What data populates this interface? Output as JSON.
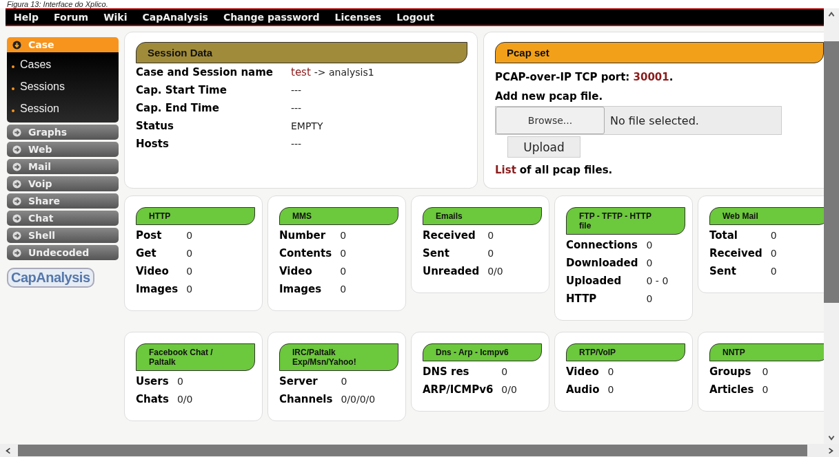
{
  "caption": "Figura 13: Interface do Xplico.",
  "nav": [
    "Help",
    "Forum",
    "Wiki",
    "CapAnalysis",
    "Change password",
    "Licenses",
    "Logout"
  ],
  "sidebar": {
    "items": [
      {
        "label": "Case",
        "selected": true,
        "expanded": true,
        "children": [
          "Cases",
          "Sessions",
          "Session"
        ]
      },
      {
        "label": "Graphs",
        "selected": false,
        "expanded": false
      },
      {
        "label": "Web",
        "selected": false,
        "expanded": false
      },
      {
        "label": "Mail",
        "selected": false,
        "expanded": false
      },
      {
        "label": "Voip",
        "selected": false,
        "expanded": false
      },
      {
        "label": "Share",
        "selected": false,
        "expanded": false
      },
      {
        "label": "Chat",
        "selected": false,
        "expanded": false
      },
      {
        "label": "Shell",
        "selected": false,
        "expanded": false
      },
      {
        "label": "Undecoded",
        "selected": false,
        "expanded": false
      }
    ],
    "logo": "CapAnalysis"
  },
  "session_data": {
    "title": "Session Data",
    "rows": [
      {
        "label": "Case and Session name",
        "link": "test",
        "value": "-> analysis1"
      },
      {
        "label": "Cap. Start Time",
        "value": "---"
      },
      {
        "label": "Cap. End Time",
        "value": "---"
      },
      {
        "label": "Status",
        "value": "EMPTY"
      },
      {
        "label": "Hosts",
        "value": "---"
      }
    ]
  },
  "pcap_set": {
    "title": "Pcap set",
    "port_label": "PCAP-over-IP TCP port:",
    "port": "30001",
    "port_end": ".",
    "add_label": "Add new pcap file.",
    "browse_button": "Browse...",
    "file_status": "No file selected.",
    "upload_button": "Upload",
    "list_link": "List",
    "list_text": "of all pcap files."
  },
  "cards": [
    {
      "title": "HTTP",
      "rows": [
        {
          "label": "Post",
          "value": "0"
        },
        {
          "label": "Get",
          "value": "0"
        },
        {
          "label": "Video",
          "value": "0"
        },
        {
          "label": "Images",
          "value": "0"
        }
      ]
    },
    {
      "title": "MMS",
      "rows": [
        {
          "label": "Number",
          "value": "0"
        },
        {
          "label": "Contents",
          "value": "0"
        },
        {
          "label": "Video",
          "value": "0"
        },
        {
          "label": "Images",
          "value": "0"
        }
      ]
    },
    {
      "title": "Emails",
      "rows": [
        {
          "label": "Received",
          "value": "0"
        },
        {
          "label": "Sent",
          "value": "0"
        },
        {
          "label": "Unreaded",
          "value": "0/0"
        }
      ]
    },
    {
      "title": "FTP - TFTP - HTTP file",
      "rows": [
        {
          "label": "Connections",
          "value": "0"
        },
        {
          "label": "Downloaded",
          "value": "0"
        },
        {
          "label": "Uploaded",
          "value": "0 - 0"
        },
        {
          "label": "HTTP",
          "value": "0"
        }
      ]
    },
    {
      "title": "Web Mail",
      "rows": [
        {
          "label": "Total",
          "value": "0"
        },
        {
          "label": "Received",
          "value": "0"
        },
        {
          "label": "Sent",
          "value": "0"
        }
      ]
    },
    {
      "title": "Facebook Chat / Paltalk",
      "rows": [
        {
          "label": "Users",
          "value": "0"
        },
        {
          "label": "Chats",
          "value": "0/0"
        }
      ]
    },
    {
      "title": "IRC/Paltalk Exp/Msn/Yahoo!",
      "rows": [
        {
          "label": "Server",
          "value": "0"
        },
        {
          "label": "Channels",
          "value": "0/0/0/0"
        }
      ]
    },
    {
      "title": "Dns - Arp - Icmpv6",
      "rows": [
        {
          "label": "DNS res",
          "value": "0"
        },
        {
          "label": "ARP/ICMPv6",
          "value": "0/0"
        }
      ]
    },
    {
      "title": "RTP/VoIP",
      "rows": [
        {
          "label": "Video",
          "value": "0"
        },
        {
          "label": "Audio",
          "value": "0"
        }
      ]
    },
    {
      "title": "NNTP",
      "rows": [
        {
          "label": "Groups",
          "value": "0"
        },
        {
          "label": "Articles",
          "value": "0"
        }
      ]
    }
  ]
}
